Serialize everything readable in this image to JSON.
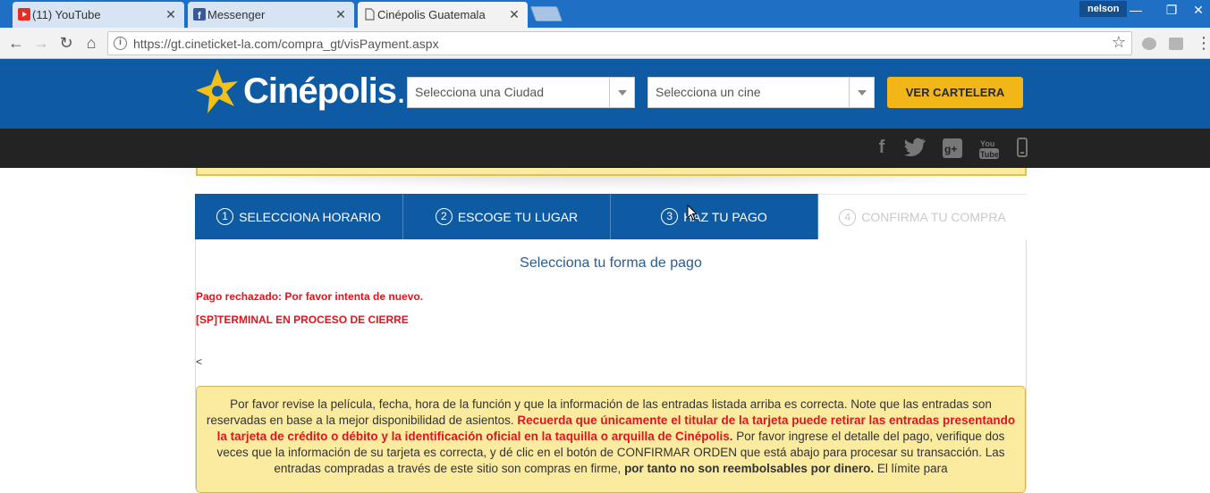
{
  "browser": {
    "tabs": [
      {
        "title": "(11) YouTube",
        "icon": "youtube-icon",
        "active": false
      },
      {
        "title": "Messenger",
        "icon": "facebook-icon",
        "active": false
      },
      {
        "title": "Cinépolis Guatemala",
        "icon": "document-icon",
        "active": true
      }
    ],
    "profile": "nelson",
    "url": "https://gt.cineticket-la.com/compra_gt/visPayment.aspx"
  },
  "site": {
    "logo": "Cinépolis",
    "city_placeholder": "Selecciona una Ciudad",
    "cinema_placeholder": "Selecciona un cine",
    "cartelera_button": "VER CARTELERA",
    "colors": {
      "header": "#0f5ba3",
      "accent": "#f2b619",
      "error": "#e0141e"
    }
  },
  "social": [
    "facebook-icon",
    "twitter-icon",
    "google-plus-icon",
    "youtube-icon",
    "mobile-icon"
  ],
  "steps": [
    {
      "num": "1",
      "label": "SELECCIONA HORARIO",
      "state": "done"
    },
    {
      "num": "2",
      "label": "ESCOGE TU LUGAR",
      "state": "done"
    },
    {
      "num": "3",
      "label": "HAZ TU PAGO",
      "state": "current"
    },
    {
      "num": "4",
      "label": "CONFIRMA TU COMPRA",
      "state": "pending"
    }
  ],
  "payment": {
    "title": "Selecciona tu forma de pago",
    "error1": "Pago rechazado: Por favor intenta de nuevo.",
    "error2": "[SP]TERMINAL EN PROCESO DE CIERRE",
    "stray": "<"
  },
  "notice": {
    "part1": "Por favor revise la película, fecha, hora de la función y que la información de las entradas listada arriba es correcta. Note que las entradas son reservadas en base a la mejor disponibilidad de asientos. ",
    "red": "Recuerda que únicamente el titular de la tarjeta puede retirar las entradas presentando la tarjeta de crédito o débito y la identificación oficial en la taquilla o arquilla de Cinépolis.",
    "part2": " Por favor ingrese el detalle del pago, verifique dos veces que la información de su tarjeta es correcta, y dé clic en el botón de CONFIRMAR ORDEN que está abajo para procesar su transacción. Las entradas compradas a través de este sitio son compras en firme, ",
    "bold": "por tanto no son reembolsables por dinero.",
    "part3": " El límite para"
  }
}
